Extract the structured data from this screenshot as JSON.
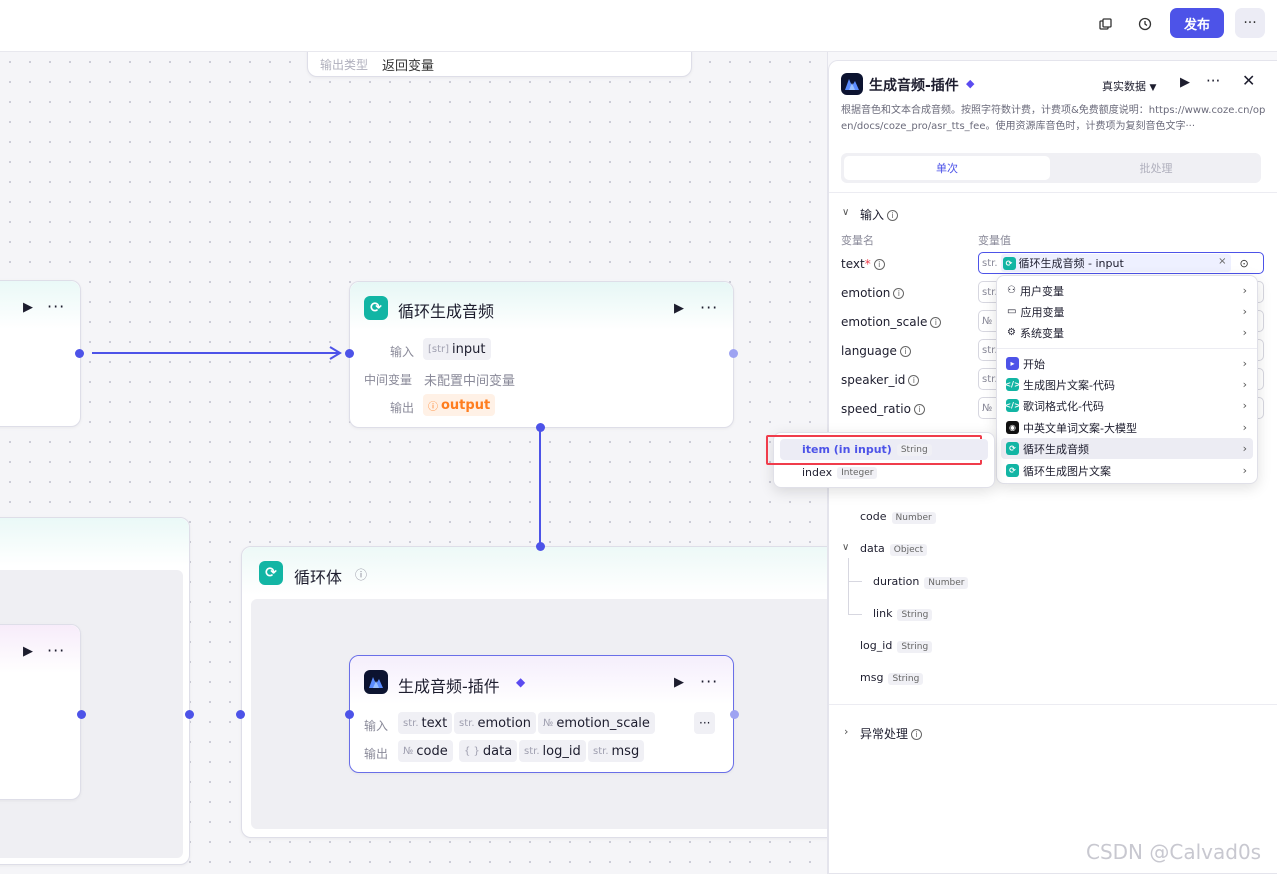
{
  "topbar": {
    "copy_icon": "copy-icon",
    "history_icon": "history-icon",
    "publish_label": "发布",
    "more_label": "···"
  },
  "canvas": {
    "top_node": {
      "output_type_label": "输出类型",
      "output_type_value": "返回变量"
    },
    "loop_node": {
      "title": "循环生成音频",
      "input_label": "输入",
      "input_type": "[str]",
      "input_value": "input",
      "mid_label": "中间变量",
      "mid_value": "未配置中间变量",
      "output_label": "输出",
      "output_value": "output"
    },
    "loop_body": {
      "title": "循环体"
    },
    "plugin_node": {
      "title": "生成音频-插件",
      "input_label": "输入",
      "inputs": [
        {
          "type": "str.",
          "name": "text"
        },
        {
          "type": "str.",
          "name": "emotion"
        },
        {
          "type": "№",
          "name": "emotion_scale"
        }
      ],
      "output_label": "输出",
      "outputs": [
        {
          "type": "№",
          "name": "code"
        },
        {
          "type": "{ }",
          "name": "data"
        },
        {
          "type": "str.",
          "name": "log_id"
        },
        {
          "type": "str.",
          "name": "msg"
        }
      ]
    },
    "more_label": "···"
  },
  "panel": {
    "title": "生成音频-插件",
    "data_mode": "真实数据",
    "description": "根据音色和文本合成音频。按照字符数计费，计费项&免费额度说明：https://www.coze.cn/open/docs/coze_pro/asr_tts_fee。使用资源库音色时，计费项为复刻音色文字···",
    "tabs": [
      "单次",
      "批处理"
    ],
    "input_section": "输入",
    "col_name": "变量名",
    "col_value": "变量值",
    "fields": [
      {
        "name": "text",
        "required": "*",
        "type": "str."
      },
      {
        "name": "emotion",
        "type": "str."
      },
      {
        "name": "emotion_scale",
        "type": "№"
      },
      {
        "name": "language",
        "type": "str."
      },
      {
        "name": "speaker_id",
        "type": "str."
      },
      {
        "name": "speed_ratio",
        "type": "№"
      }
    ],
    "selected_value": "循环生成音频 - input",
    "clear_label": "×",
    "outputs": [
      {
        "name": "code",
        "type": "Number"
      },
      {
        "name": "data",
        "type": "Object"
      },
      {
        "name": "duration",
        "type": "Number"
      },
      {
        "name": "link",
        "type": "String"
      },
      {
        "name": "log_id",
        "type": "String"
      },
      {
        "name": "msg",
        "type": "String"
      }
    ],
    "exception_section": "异常处理"
  },
  "var_menu": {
    "items": [
      {
        "label": "用户变量",
        "icon": "user-icon"
      },
      {
        "label": "应用变量",
        "icon": "app-icon"
      },
      {
        "label": "系统变量",
        "icon": "gear-icon"
      },
      {
        "label": "开始",
        "icon": "start-icon"
      },
      {
        "label": "生成图片文案-代码",
        "icon": "code-icon"
      },
      {
        "label": "歌词格式化-代码",
        "icon": "code-icon"
      },
      {
        "label": "中英文单词文案-大模型",
        "icon": "llm-icon"
      },
      {
        "label": "循环生成音频",
        "icon": "loop-icon"
      },
      {
        "label": "循环生成图片文案",
        "icon": "loop-icon"
      }
    ]
  },
  "sub_menu": {
    "items": [
      {
        "label": "item (in input)",
        "type": "String"
      },
      {
        "label": "index",
        "type": "Integer"
      }
    ]
  },
  "watermark": "CSDN @Calvad0s",
  "colors": {
    "accent": "#4d53e8",
    "teal": "#12b5a4",
    "orange": "#ff7d1f",
    "highlight": "#f03c4b"
  }
}
